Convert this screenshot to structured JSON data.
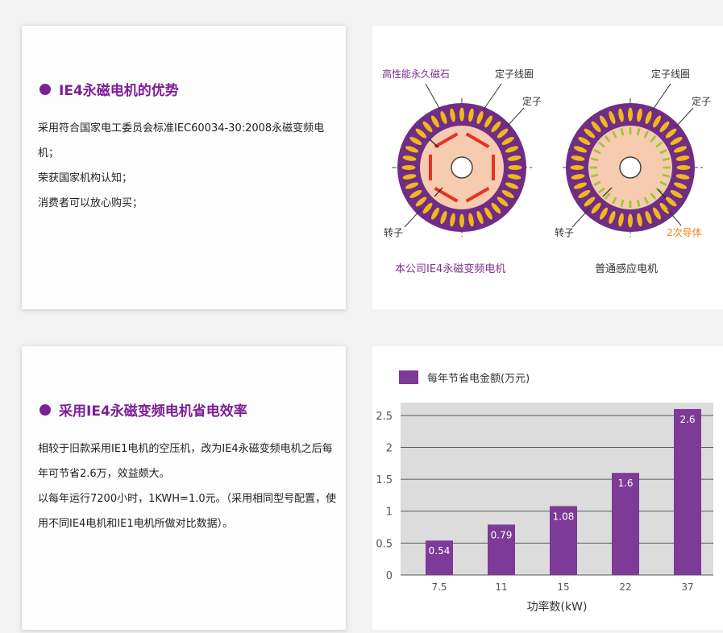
{
  "section1": {
    "title": "IE4永磁电机的优势",
    "lines": [
      "采用符合国家电工委员会标准IEC60034-30:2008永磁变频电机；",
      "荣获国家机构认知；",
      "消费者可以放心购买；"
    ]
  },
  "diagram": {
    "left_labels": {
      "magnet": "高性能永久磁石",
      "coil": "定子线圈",
      "stator": "定子",
      "rotor": "转子",
      "caption": "本公司IE4永磁变频电机"
    },
    "right_labels": {
      "coil": "定子线圈",
      "stator": "定子",
      "rotor": "转子",
      "conductor": "2次导体",
      "caption": "普通感应电机"
    },
    "colors": {
      "purple": "#6f2d86",
      "coil": "#f2b81a",
      "rotor": "#f7cbb0",
      "magnet": "#e53222",
      "conductor": "#9cc83a",
      "conductor_label": "#f07f1b",
      "caption_left": "#7d2f8f"
    }
  },
  "section2": {
    "title": "采用IE4永磁变频电机省电效率",
    "lines": [
      "相较于旧款采用IE1电机的空压机，改为IE4永磁变频电机之后每年可节省2.6万，效益颇大。",
      "以每年运行7200小时，1KWH=1.0元。（采用相同型号配置，使用不同IE4电机和IE1电机所做对比数据）。"
    ]
  },
  "chart_data": {
    "type": "bar",
    "categories": [
      "7.5",
      "11",
      "15",
      "22",
      "37"
    ],
    "series": [
      {
        "name": "每年节省电金额(万元)",
        "values": [
          0.54,
          0.79,
          1.08,
          1.6,
          2.6
        ],
        "labels": [
          "0.54",
          "0.79",
          "1.08",
          "1.6",
          "2.6"
        ]
      }
    ],
    "xlabel": "功率数(kW)",
    "ylabel": "",
    "ylim": [
      0,
      2.7
    ],
    "yticks": [
      0,
      0.5,
      1,
      1.5,
      2,
      2.5
    ],
    "ytick_labels": [
      "0",
      "0.5",
      "1",
      "1.5",
      "2",
      "2.5"
    ],
    "grid": true,
    "legend": "top-left",
    "colors": {
      "bar": "#7d3a96",
      "plot_bg": "#dcdcdc",
      "grid": "#5a5a5a"
    }
  }
}
